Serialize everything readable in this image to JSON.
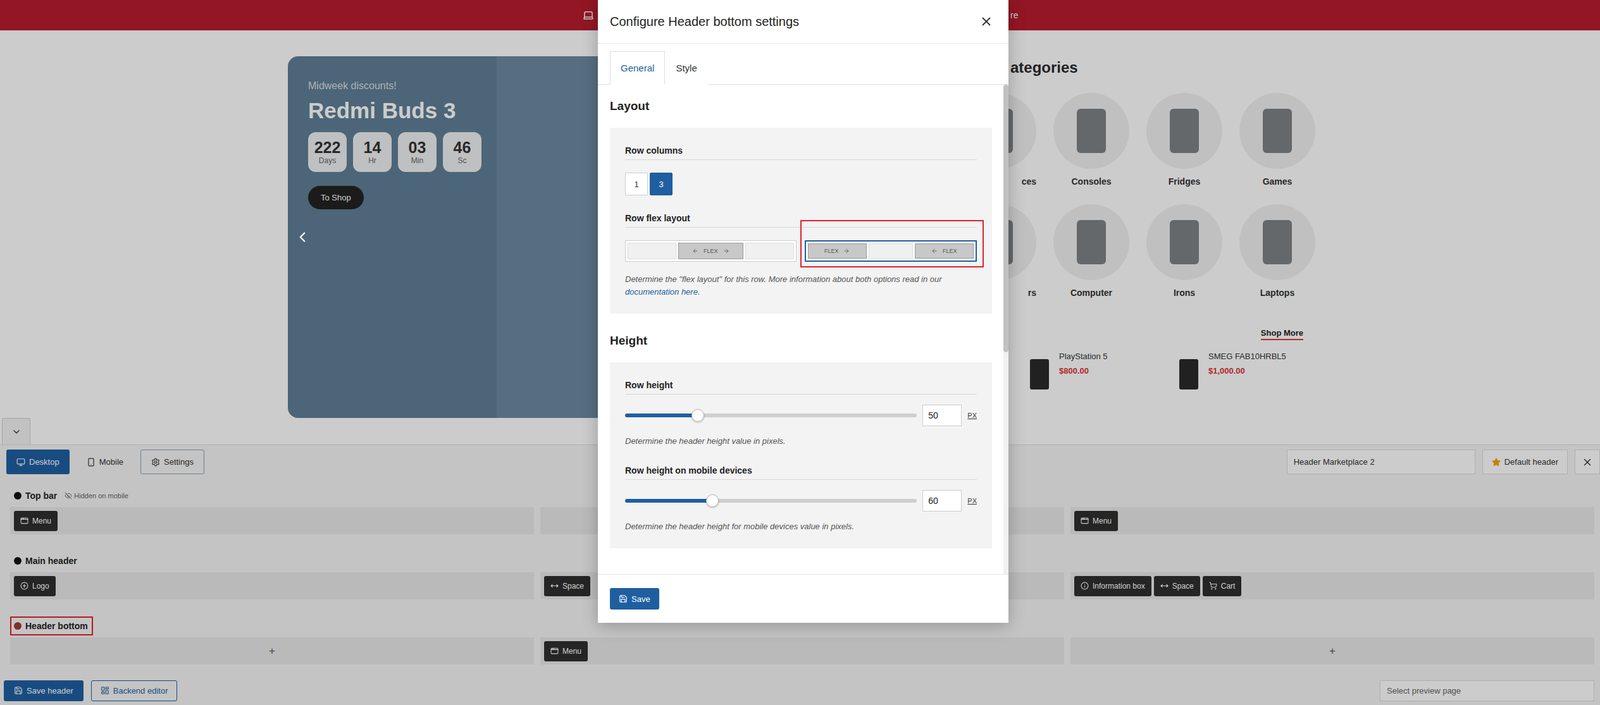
{
  "topbar": {
    "text": "re"
  },
  "hero": {
    "eyebrow": "Midweek discounts!",
    "title": "Redmi Buds 3",
    "countdown": [
      {
        "value": "222",
        "unit": "Days"
      },
      {
        "value": "14",
        "unit": "Hr"
      },
      {
        "value": "03",
        "unit": "Min"
      },
      {
        "value": "46",
        "unit": "Sc"
      }
    ],
    "button": "To Shop"
  },
  "categories": {
    "title": "ategories",
    "rows": [
      [
        "ces",
        "Consoles",
        "Fridges",
        "Games"
      ],
      [
        "rs",
        "Computer",
        "Irons",
        "Laptops"
      ]
    ]
  },
  "products": {
    "link": "Shop More",
    "items": [
      {
        "name": "PlayStation 5",
        "price": "$800.00"
      },
      {
        "name": "SMEG FAB10HRBL5",
        "price": "$1,000.00"
      }
    ]
  },
  "builder": {
    "devices": [
      {
        "label": "Desktop",
        "kind": "desktop",
        "selected": true
      },
      {
        "label": "Mobile",
        "kind": "mobile",
        "selected": false
      }
    ],
    "settings": "Settings",
    "header_name": "Header Marketplace 2",
    "default_button": "Default header",
    "add": "+",
    "rows": [
      {
        "name": "Top bar",
        "color": "#111111",
        "highlighted": false,
        "badge": "Hidden on mobile",
        "columns": [
          [
            {
              "label": "Menu",
              "kind": "menu"
            }
          ],
          [],
          [
            {
              "label": "Menu",
              "kind": "menu"
            }
          ]
        ]
      },
      {
        "name": "Main header",
        "color": "#111111",
        "highlighted": false,
        "badge": "",
        "columns": [
          [
            {
              "label": "Logo",
              "kind": "logo"
            }
          ],
          [
            {
              "label": "Space",
              "kind": "space"
            }
          ],
          [
            {
              "label": "Information box",
              "kind": "info"
            },
            {
              "label": "Space",
              "kind": "space"
            },
            {
              "label": "Cart",
              "kind": "cart"
            }
          ]
        ]
      },
      {
        "name": "Header bottom",
        "color": "#a33a3a",
        "highlighted": true,
        "badge": "",
        "columns": [
          [],
          [
            {
              "label": "Menu",
              "kind": "menu"
            }
          ],
          []
        ]
      }
    ],
    "save": "Save header",
    "backend": "Backend editor",
    "preview_placeholder": "Select preview page"
  },
  "modal": {
    "title": "Configure Header bottom settings",
    "tabs": [
      {
        "label": "General",
        "selected": true
      },
      {
        "label": "Style",
        "selected": false
      }
    ],
    "sections": [
      {
        "title": "Layout",
        "fields": [
          {
            "kind": "buttons",
            "label": "Row columns",
            "options": [
              {
                "label": "1",
                "selected": false
              },
              {
                "label": "3",
                "selected": true
              }
            ]
          },
          {
            "kind": "flex",
            "label": "Row flex layout",
            "options": [
              {
                "selected": false,
                "highlighted": false,
                "cells": [
                  {
                    "flex": false
                  },
                  {
                    "flex": true,
                    "label": "FLEX",
                    "arrow_left": true,
                    "arrow_right": true
                  },
                  {
                    "flex": false
                  }
                ]
              },
              {
                "selected": true,
                "highlighted": true,
                "cells": [
                  {
                    "flex": true,
                    "label": "FLEX",
                    "arrow_left": false,
                    "arrow_right": true
                  },
                  {
                    "flex": false
                  },
                  {
                    "flex": true,
                    "label": "FLEX",
                    "arrow_left": true,
                    "arrow_right": false
                  }
                ]
              }
            ],
            "description": "Determine the \"flex layout\" for this row. More information about both options read in our ",
            "link": "documentation here",
            "description_end": "."
          }
        ]
      },
      {
        "title": "Height",
        "fields": [
          {
            "kind": "slider",
            "label": "Row height",
            "level": 0.25,
            "value": "50",
            "unit": "PX",
            "description": "Determine the header height value in pixels."
          },
          {
            "kind": "slider",
            "label": "Row height on mobile devices",
            "level": 0.3,
            "value": "60",
            "unit": "PX",
            "description": "Determine the header height for mobile devices value in pixels."
          }
        ]
      }
    ],
    "save": "Save"
  }
}
